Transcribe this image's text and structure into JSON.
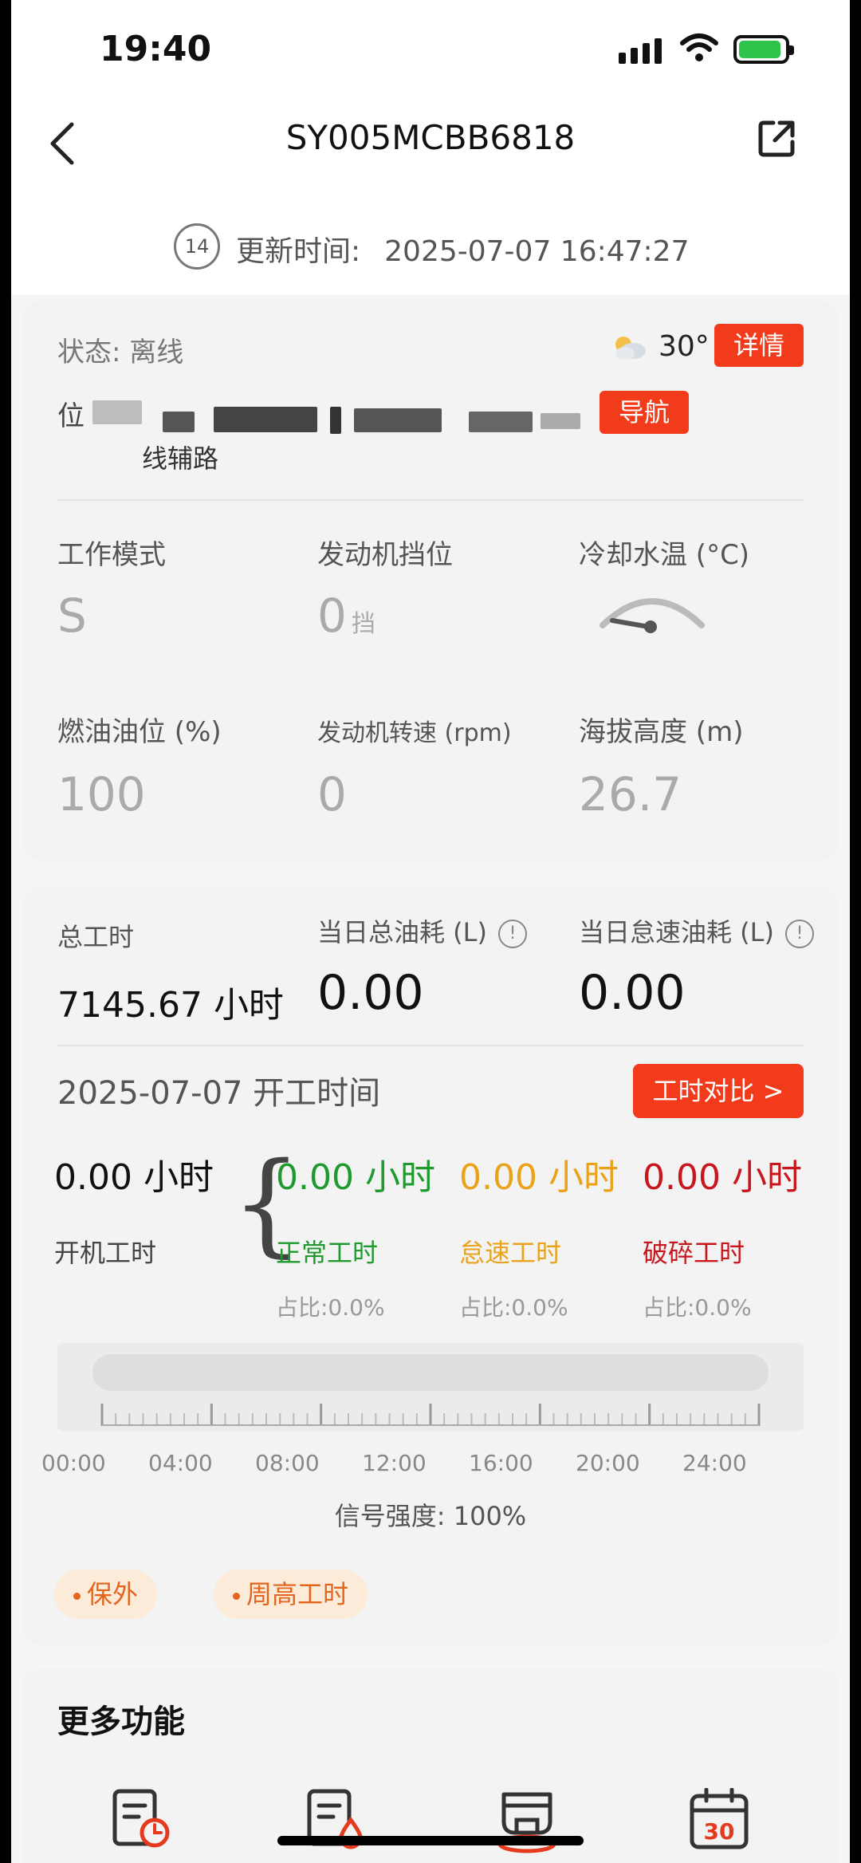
{
  "status_bar": {
    "time": "19:40"
  },
  "header": {
    "title": "SY005MCBB6818"
  },
  "updated": {
    "countdown": "14",
    "label": "更新时间:",
    "value": "2025-07-07 16:47:27"
  },
  "overview": {
    "status_label": "状态: 离线",
    "weather_temp": "30°",
    "details_button": "详情",
    "location_label": "位",
    "location_line2": "线辅路",
    "navigate_button": "导航",
    "metrics": [
      {
        "label": "工作模式",
        "value": "S",
        "unit": ""
      },
      {
        "label": "发动机挡位",
        "value": "0",
        "unit": "挡"
      },
      {
        "label": "冷却水温 (°C)",
        "value": "",
        "unit": ""
      },
      {
        "label": "燃油油位 (%)",
        "value": "100",
        "unit": ""
      },
      {
        "label": "发动机转速 (rpm)",
        "value": "0",
        "unit": ""
      },
      {
        "label": "海拔高度 (m)",
        "value": "26.7",
        "unit": ""
      }
    ]
  },
  "work": {
    "total_hours_label": "总工时",
    "total_hours_value": "7145.67 小时",
    "daily_fuel_label": "当日总油耗 (L)",
    "daily_fuel_value": "0.00",
    "idle_fuel_label": "当日怠速油耗 (L)",
    "idle_fuel_value": "0.00",
    "info_symbol": "!",
    "date_title": "2025-07-07 开工时间",
    "compare_button": "工时对比 >",
    "runtime_value": "0.00 小时",
    "runtime_label": "开机工时",
    "brace": "{",
    "categories": [
      {
        "value": "0.00 小时",
        "label": "正常工时",
        "pct": "占比:0.0%",
        "color": "#1f9a2e"
      },
      {
        "value": "0.00 小时",
        "label": "怠速工时",
        "pct": "占比:0.0%",
        "color": "#e9a21a"
      },
      {
        "value": "0.00 小时",
        "label": "破碎工时",
        "pct": "占比:0.0%",
        "color": "#c8161d"
      }
    ],
    "timeline_labels": [
      "00:00",
      "04:00",
      "08:00",
      "12:00",
      "16:00",
      "20:00",
      "24:00"
    ],
    "signal": "信号强度: 100%",
    "chips": [
      "保外",
      "周高工时"
    ]
  },
  "more": {
    "title": "更多功能",
    "icon_calendar_day": "30"
  }
}
